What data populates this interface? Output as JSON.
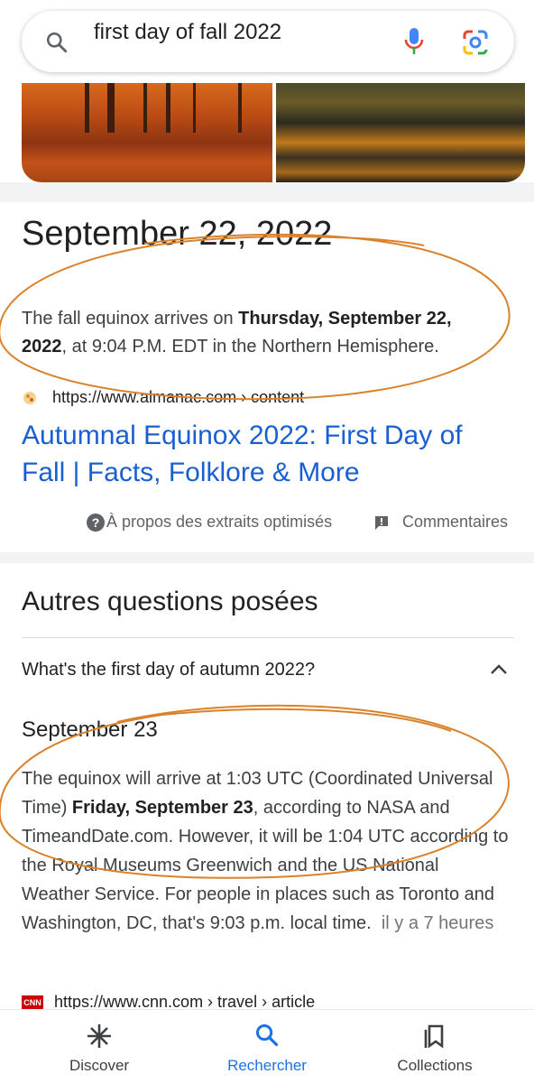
{
  "search": {
    "query": "first day of fall 2022"
  },
  "featured": {
    "date_title": "September 22, 2022",
    "snippet_pre": "The fall equinox arrives on ",
    "snippet_bold": "Thursday, September 22, 2022",
    "snippet_post": ", at 9:04 P.M. EDT in the Northern Hemisphere.",
    "source_url": "https://www.almanac.com › content",
    "result_title": "Autumnal Equinox 2022: First Day of Fall | Facts, Folklore & More",
    "about_label": "À propos des extraits optimisés",
    "feedback_label": "Commentaires"
  },
  "paa": {
    "heading": "Autres questions posées",
    "question": "What's the first day of autumn 2022?",
    "answer_title": "September 23",
    "answer_pre": "The equinox will arrive at 1:03 UTC (Coordinated Universal Time) ",
    "answer_bold": "Friday, September 23",
    "answer_post": ", according to NASA and TimeandDate.com. However, it will be 1:04 UTC according to the Royal Museums Greenwich and the US National Weather Service. For people in places such as Toronto and Washington, DC, that's 9:03 p.m. local time.",
    "answer_age": "il y a 7 heures",
    "cnn_logo": "CNN",
    "cnn_url": "https://www.cnn.com › travel › article"
  },
  "nav": {
    "items": [
      {
        "label": "Discover",
        "icon": "asterisk-icon"
      },
      {
        "label": "Rechercher",
        "icon": "search-icon"
      },
      {
        "label": "Collections",
        "icon": "collections-icon"
      }
    ],
    "active_index": 1
  },
  "colors": {
    "link_blue": "#1a5fd1",
    "active_blue": "#1a73e8",
    "annotation_orange": "#d9822b"
  }
}
